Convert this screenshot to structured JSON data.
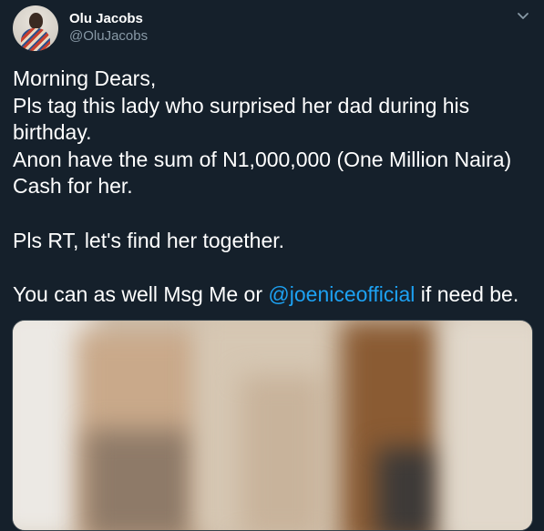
{
  "author": {
    "name": "Olu Jacobs",
    "handle": "@OluJacobs"
  },
  "tweet": {
    "lines": [
      "Morning Dears,",
      "Pls tag this lady who surprised her dad during his birthday.",
      "Anon have the sum of N1,000,000 (One Million Naira) Cash for her.",
      "",
      "Pls RT, let's find her together.",
      "",
      "You can as well Msg Me or "
    ],
    "mention": "@joeniceofficial",
    "after_mention": " if need be."
  },
  "icons": {
    "more": "chevron-down-icon",
    "avatar": "profile-photo"
  },
  "colors": {
    "background": "#15202b",
    "text": "#ffffff",
    "secondary_text": "#8899a6",
    "link": "#1da1f2"
  }
}
